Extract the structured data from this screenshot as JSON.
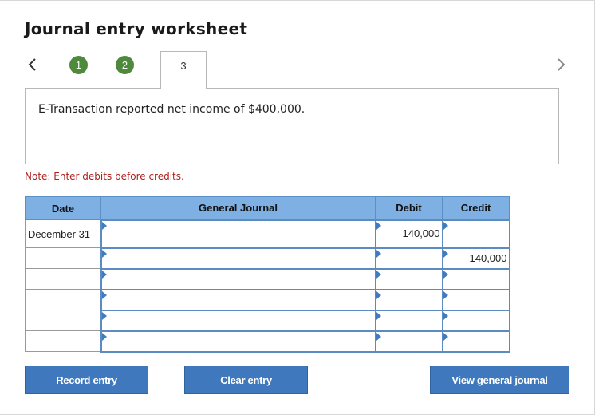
{
  "title": "Journal entry worksheet",
  "nav": {
    "prev_icon": "chevron-left-icon",
    "next_icon": "chevron-right-icon",
    "steps": [
      "1",
      "2",
      "3"
    ],
    "active_step": "3",
    "completed_color": "#4f8a3c"
  },
  "transaction": {
    "description": "E-Transaction reported net income of $400,000."
  },
  "note": "Note: Enter debits before credits.",
  "table": {
    "headers": {
      "date": "Date",
      "journal": "General Journal",
      "debit": "Debit",
      "credit": "Credit"
    },
    "rows": [
      {
        "date": "December 31",
        "account": "",
        "debit": "140,000",
        "credit": ""
      },
      {
        "date": "",
        "account": "",
        "debit": "",
        "credit": "140,000"
      },
      {
        "date": "",
        "account": "",
        "debit": "",
        "credit": ""
      },
      {
        "date": "",
        "account": "",
        "debit": "",
        "credit": ""
      },
      {
        "date": "",
        "account": "",
        "debit": "",
        "credit": ""
      },
      {
        "date": "",
        "account": "",
        "debit": "",
        "credit": ""
      }
    ]
  },
  "buttons": {
    "record": "Record entry",
    "clear": "Clear entry",
    "view": "View general journal"
  },
  "colors": {
    "header_bg": "#7fb0e4",
    "button_bg": "#3f78bd",
    "note_color": "#b1201d"
  }
}
